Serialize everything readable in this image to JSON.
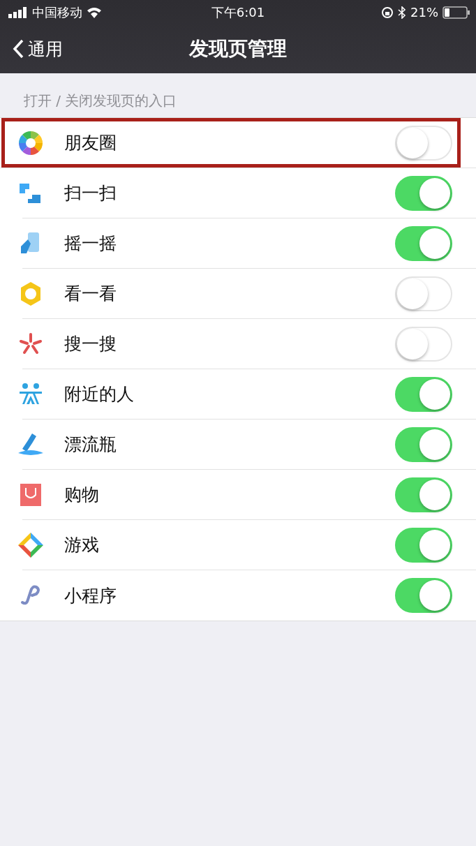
{
  "status_bar": {
    "carrier": "中国移动",
    "time": "下午6:01",
    "battery": "21%"
  },
  "nav": {
    "back": "通用",
    "title": "发现页管理"
  },
  "section_label": "打开 / 关闭发现页的入口",
  "items": [
    {
      "kind": "moments",
      "label": "朋友圈",
      "on": false,
      "highlighted": true
    },
    {
      "kind": "scan",
      "label": "扫一扫",
      "on": true,
      "highlighted": false
    },
    {
      "kind": "shake",
      "label": "摇一摇",
      "on": true,
      "highlighted": false
    },
    {
      "kind": "look",
      "label": "看一看",
      "on": false,
      "highlighted": false
    },
    {
      "kind": "search",
      "label": "搜一搜",
      "on": false,
      "highlighted": false
    },
    {
      "kind": "nearby",
      "label": "附近的人",
      "on": true,
      "highlighted": false
    },
    {
      "kind": "bottle",
      "label": "漂流瓶",
      "on": true,
      "highlighted": false
    },
    {
      "kind": "shop",
      "label": "购物",
      "on": true,
      "highlighted": false
    },
    {
      "kind": "games",
      "label": "游戏",
      "on": true,
      "highlighted": false
    },
    {
      "kind": "miniprogram",
      "label": "小程序",
      "on": true,
      "highlighted": false
    }
  ]
}
